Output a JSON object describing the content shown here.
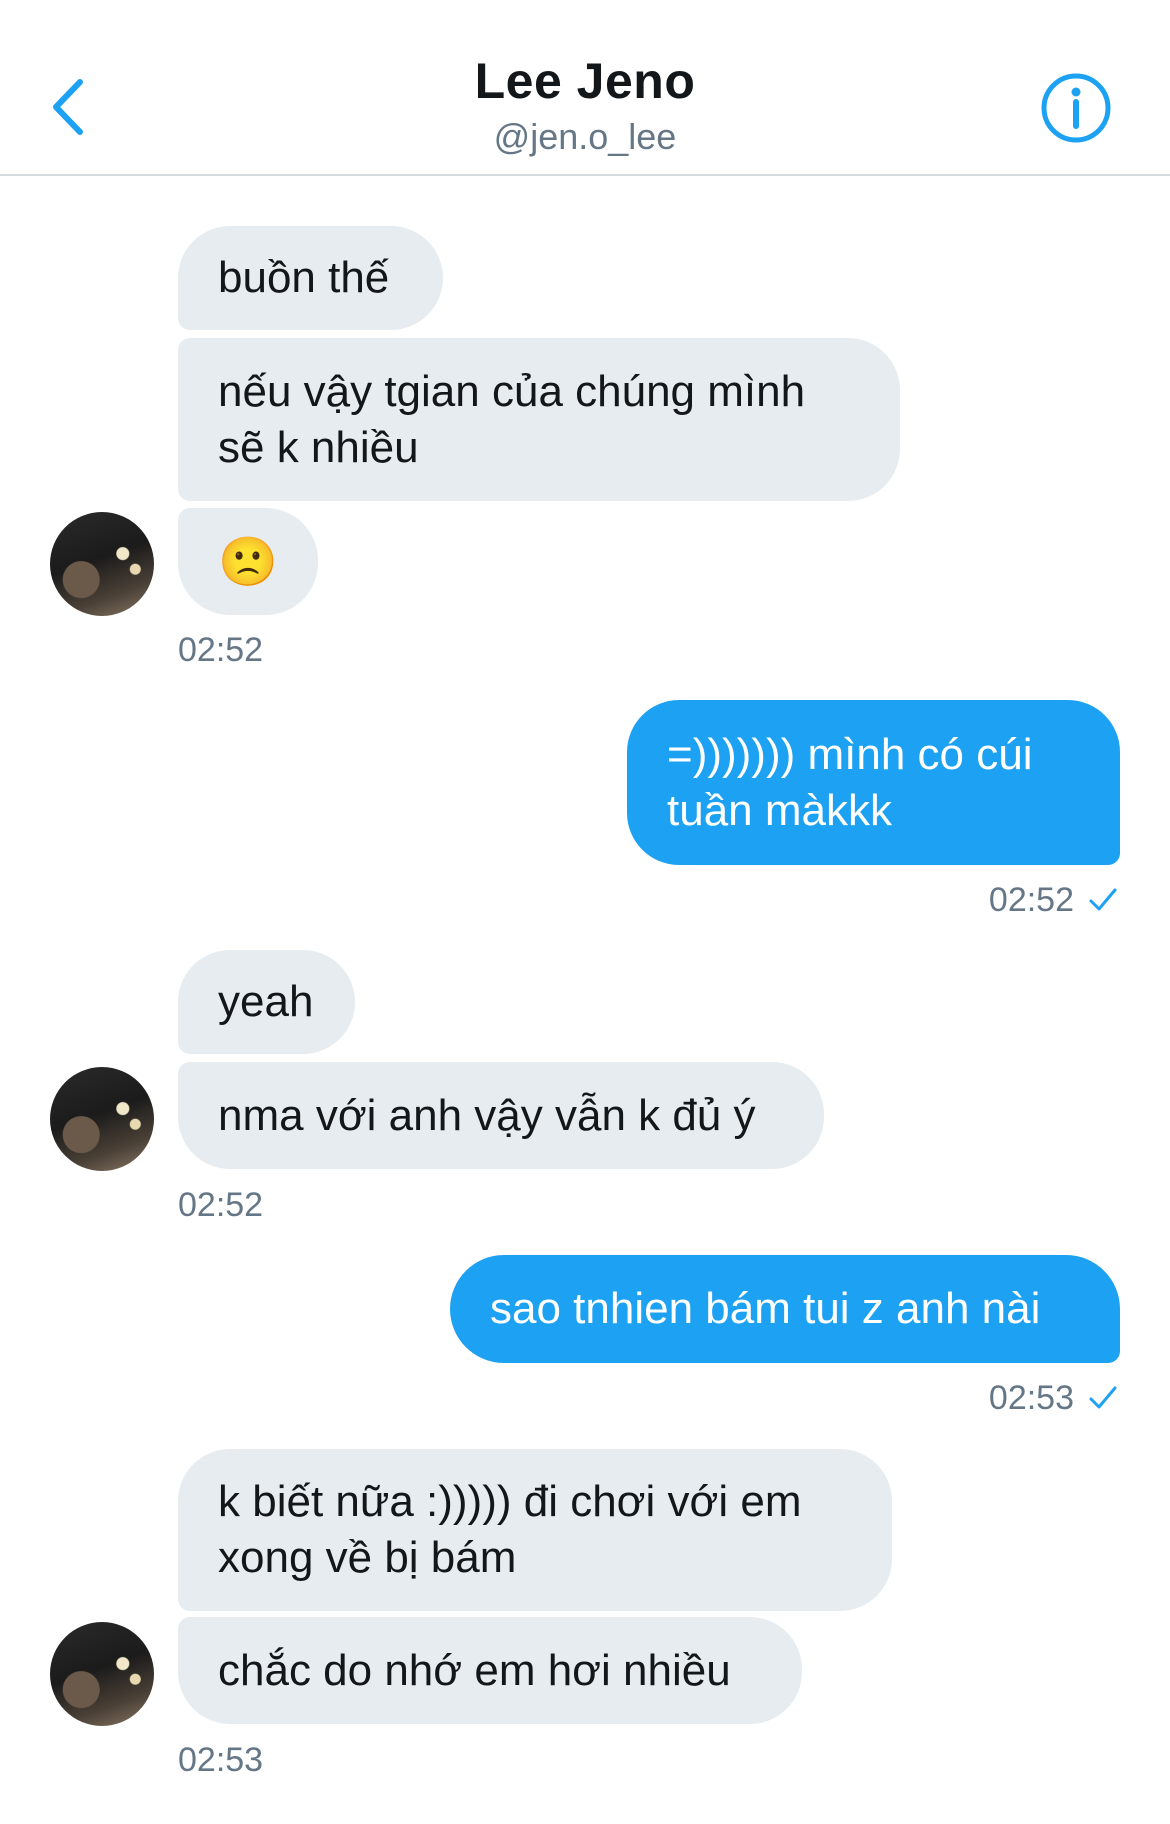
{
  "header": {
    "title": "Lee Jeno",
    "handle": "@jen.o_lee"
  },
  "messages": [
    {
      "text": "buồn thế"
    },
    {
      "text": "nếu vậy tgian của chúng mình sẽ k nhiều"
    },
    {
      "text": "🙁"
    },
    {
      "time": "02:52"
    },
    {
      "text": "=))))))) mình có cúi tuần màkkk"
    },
    {
      "time": "02:52"
    },
    {
      "text": "yeah"
    },
    {
      "text": "nma với anh vậy vẫn k đủ ý"
    },
    {
      "time": "02:52"
    },
    {
      "text": "sao tnhien bám tui z anh nài"
    },
    {
      "time": "02:53"
    },
    {
      "text": "k biết nữa :))))) đi chơi với em xong về bị bám"
    },
    {
      "text": "chắc do nhớ em hơi nhiều"
    },
    {
      "time": "02:53"
    }
  ],
  "colors": {
    "accent": "#1da1f2",
    "incoming_bubble": "#e6ecf0",
    "muted_text": "#657786"
  },
  "icons": {
    "back": "chevron-left-icon",
    "info": "info-icon",
    "read_receipt": "checkmark-icon"
  }
}
